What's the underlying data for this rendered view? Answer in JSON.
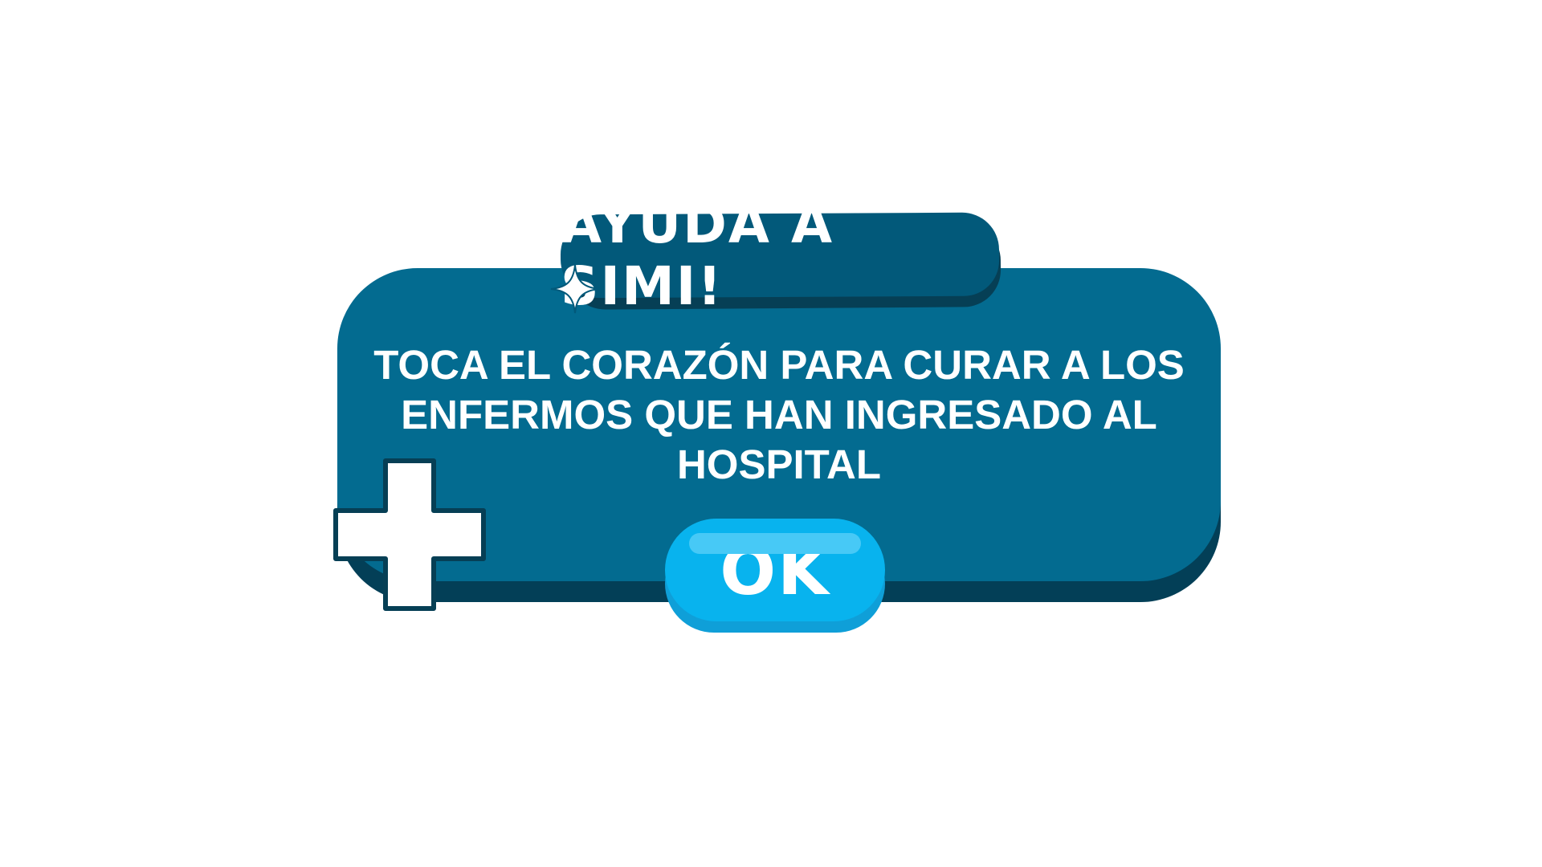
{
  "dialog": {
    "title": "AYUDA A SIMI!",
    "message": "TOCA EL CORAZÓN PARA CURAR A LOS ENFERMOS QUE HAN INGRESADO AL HOSPITAL",
    "ok_label": "OK",
    "icons": [
      "sparkle-icon",
      "medical-cross-icon"
    ]
  },
  "colors": {
    "background": "#ffffff",
    "dialog": "#036b90",
    "dialog_shadow": "#033f57",
    "title_ribbon": "#02597a",
    "ok_button": "#08b3ee",
    "text": "#ffffff"
  }
}
